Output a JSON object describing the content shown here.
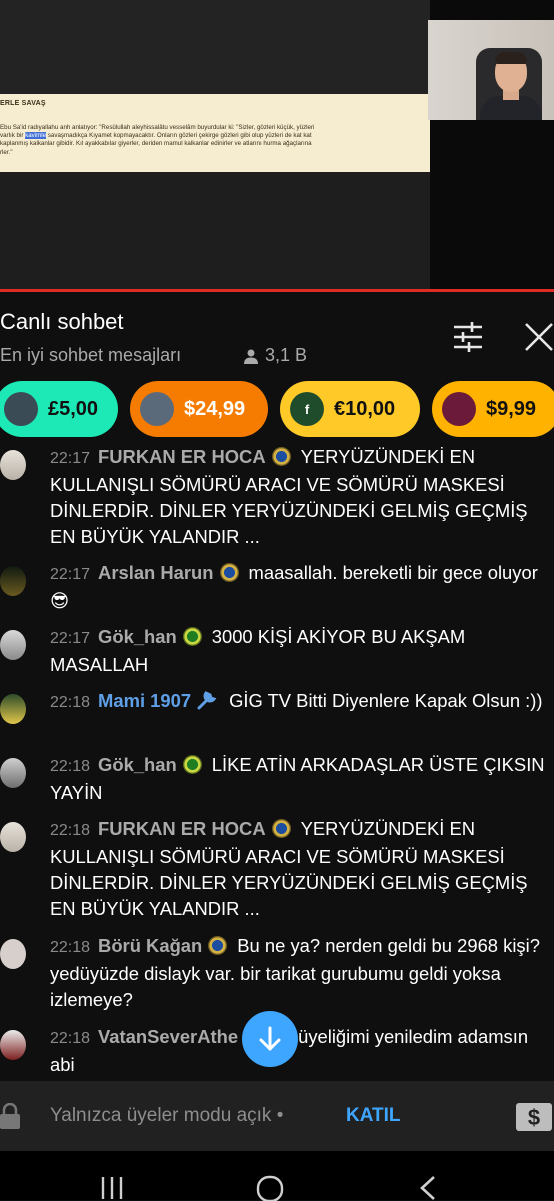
{
  "video": {
    "doc_title": "ERLE SAVAŞ",
    "doc_line1": "Ebu Sa'id radıyallahu anh anlatıyor: \"Resûlullah aleyhissalâtu vesselâm buyurdular ki: \"Sizler, gözleri küçük, yüzleri",
    "doc_line2_pre": "varlık bir ",
    "doc_line2_hl": "kavimle",
    "doc_line2_post": " savaşmadıkça Kıyamet kopmayacaktır. Onların gözleri çekirge gözleri gibi olup yüzleri de kat kat",
    "doc_line3": "kaplanmış kalkanlar gibidir. Kıl ayakkabılar giyerler, deriden mamul kalkanlar edinirler ve atlarını hurma ağaçlarına",
    "doc_line4": "rler.\"",
    "progress_color": "#e02a24"
  },
  "chat": {
    "title": "Canlı sohbet",
    "mode": "En iyi sohbet mesajları",
    "viewers": "3,1 B",
    "filter_icon": "tune-icon",
    "close_icon": "close-icon"
  },
  "super_chats": [
    {
      "amount": "£5,00",
      "color": "#1de9b6"
    },
    {
      "amount": "$24,99",
      "color": "#f57c00"
    },
    {
      "amount": "€10,00",
      "color": "#ffca28",
      "avatar_letter": "f"
    },
    {
      "amount": "$9,99",
      "color": "#ffb300"
    }
  ],
  "messages": [
    {
      "time": "22:17",
      "author": "FURKAN ER HOCA",
      "badge": "blue",
      "text": "YERYÜZÜNDEKİ EN KULLANIŞLI SÖMÜRÜ ARACI VE SÖMÜRÜ MASKESİ DİNLERDİR. DİNLER YERYÜZÜNDEKİ GELMİŞ GEÇMİŞ EN BÜYÜK YALANDIR ..."
    },
    {
      "time": "22:17",
      "author": "Arslan Harun",
      "badge": "blue",
      "text": "maasallah. bereketli bir gece oluyor 😎"
    },
    {
      "time": "22:17",
      "author": "Gök_han",
      "badge": "green",
      "text": "3000 KİŞİ AKİYOR BU AKŞAM MASALLAH"
    },
    {
      "time": "22:18",
      "author": "Mami 1907",
      "badge": "wrench",
      "text": "GİG TV Bitti Diyenlere Kapak Olsun :))"
    },
    {
      "time": "22:18",
      "author": "Gök_han",
      "badge": "green",
      "text": "LİKE ATİN ARKADAŞLAR ÜSTE ÇIKSIN YAYİN"
    },
    {
      "time": "22:18",
      "author": "FURKAN ER HOCA",
      "badge": "blue",
      "text": "YERYÜZÜNDEKİ EN KULLANIŞLI SÖMÜRÜ ARACI VE SÖMÜRÜ MASKESİ DİNLERDİR. DİNLER YERYÜZÜNDEKİ GELMİŞ GEÇMİŞ EN BÜYÜK YALANDIR ..."
    },
    {
      "time": "22:18",
      "author": "Börü Kağan",
      "badge": "blue",
      "text": "Bu ne ya? nerden geldi bu 2968 kişi? yedüyüzde dislayk var. bir tarikat gurubumu geldi yoksa izlemeye?"
    },
    {
      "time": "22:18",
      "author": "VatanSeverAthe",
      "badge": "none",
      "text": "üyeliğimi yeniledim adamsın abi"
    }
  ],
  "input": {
    "note": "Yalnızca üyeler modu açık",
    "separator": "•",
    "join": "KATIL"
  }
}
